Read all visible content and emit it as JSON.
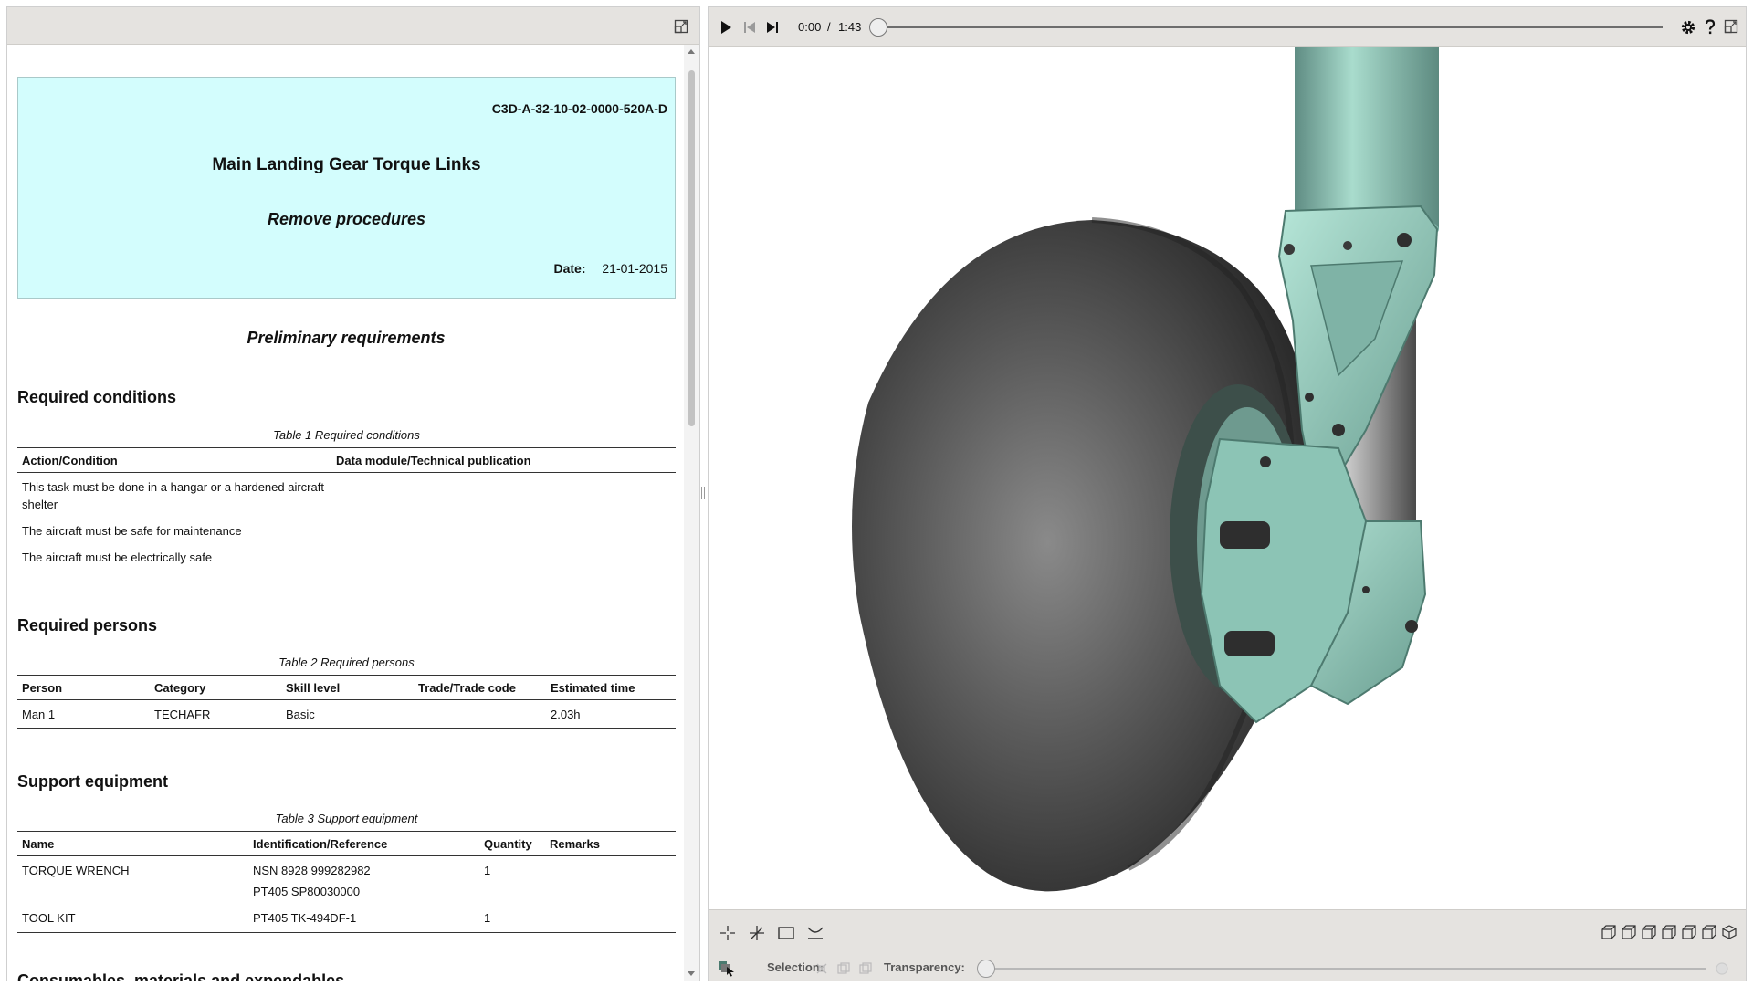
{
  "document": {
    "dm_code": "C3D-A-32-10-02-0000-520A-D",
    "title": "Main Landing Gear Torque Links",
    "subtitle": "Remove procedures",
    "date_label": "Date:",
    "date_value": "21-01-2015",
    "prelim_heading": "Preliminary requirements",
    "required_conditions": {
      "heading": "Required conditions",
      "caption": "Table 1 Required conditions",
      "columns": [
        "Action/Condition",
        "Data module/Technical publication"
      ],
      "rows": [
        [
          "This task must be done in a hangar or a hardened aircraft shelter",
          ""
        ],
        [
          "The aircraft must be safe for maintenance",
          ""
        ],
        [
          "The aircraft must be electrically safe",
          ""
        ]
      ]
    },
    "required_persons": {
      "heading": "Required persons",
      "caption": "Table 2 Required persons",
      "columns": [
        "Person",
        "Category",
        "Skill level",
        "Trade/Trade code",
        "Estimated time"
      ],
      "rows": [
        [
          "Man 1",
          "TECHAFR",
          "Basic",
          "",
          "2.03h"
        ]
      ]
    },
    "support_equipment": {
      "heading": "Support equipment",
      "caption": "Table 3 Support equipment",
      "columns": [
        "Name",
        "Identification/Reference",
        "Quantity",
        "Remarks"
      ],
      "rows": [
        [
          "TORQUE WRENCH",
          "NSN 8928 999282982",
          "1",
          ""
        ],
        [
          "",
          "PT405 SP80030000",
          "",
          ""
        ],
        [
          "TOOL KIT",
          "PT405 TK-494DF-1",
          "1",
          ""
        ]
      ]
    },
    "next_heading": "Consumables, materials and expendables"
  },
  "player": {
    "time_current": "0:00",
    "time_separator": "/",
    "time_total": "1:43",
    "progress": 0
  },
  "bottom_toolbar": {
    "selection_label": "Selection:",
    "transparency_label": "Transparency:",
    "transparency_value": 0
  },
  "icons": {
    "left_maximize": "maximize-icon",
    "play": "play-icon",
    "prev": "previous-icon",
    "next": "next-icon",
    "settings": "gear-icon",
    "help": "help-icon",
    "fullscreen": "maximize-icon"
  },
  "colors": {
    "title_box_bg": "#d3fdfd",
    "toolbar_bg": "#e5e3e0",
    "gear_model": "#8cc4b5",
    "tyre": "#555555"
  }
}
